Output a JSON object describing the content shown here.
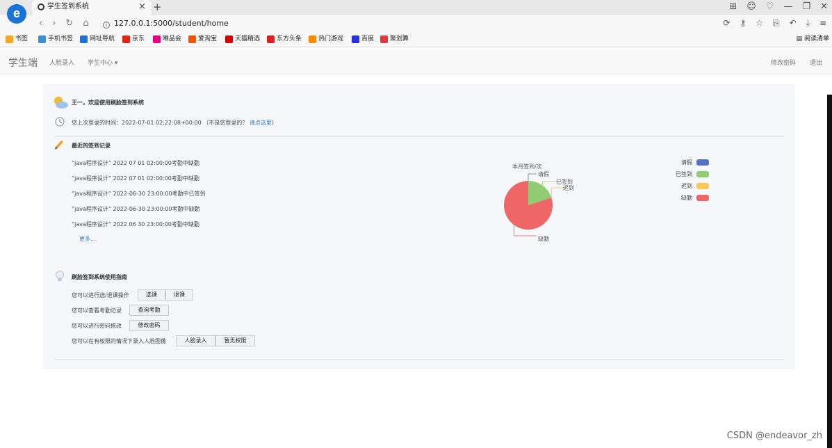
{
  "browser": {
    "tab_title": "学生签到系统",
    "tab_close": "×",
    "new_tab": "+",
    "url": "127.0.0.1:5000/student/home",
    "logo": "e",
    "reading_list": "阅读清单",
    "bookmarks": [
      {
        "label": "书签",
        "color": "#f5a623",
        "icon": "star-icon"
      },
      {
        "label": "手机书签",
        "color": "#3b8de0",
        "icon": "phone-icon"
      },
      {
        "label": "网址导航",
        "color": "#1a73d6",
        "icon": "browser-icon"
      },
      {
        "label": "京东",
        "color": "#e1251b",
        "icon": "jd-icon"
      },
      {
        "label": "唯品会",
        "color": "#e4007f",
        "icon": "vip-icon"
      },
      {
        "label": "爱淘宝",
        "color": "#ff5000",
        "icon": "taobao-icon"
      },
      {
        "label": "天猫精选",
        "color": "#d10000",
        "icon": "tmall-icon"
      },
      {
        "label": "东方头条",
        "color": "#e02020",
        "icon": "toutiao-icon"
      },
      {
        "label": "热门游戏",
        "color": "#ff8a00",
        "icon": "game-icon"
      },
      {
        "label": "百度",
        "color": "#2932e1",
        "icon": "baidu-icon"
      },
      {
        "label": "聚划算",
        "color": "#e4393c",
        "icon": "juhuasuan-icon"
      }
    ]
  },
  "nav": {
    "brand": "学生端",
    "face_entry": "人脸录入",
    "student_center": "学生中心 ▾",
    "change_password": "修改密码",
    "logout": "退出"
  },
  "welcome": {
    "title": "王一，欢迎使用刷脸签到系统",
    "last_login_prefix": "您上次登录的时间：2022-07-01 02:22:08+00:00",
    "not_you": "（不是您登录的？",
    "click_here": "请点这里",
    "close_paren": "）"
  },
  "records": {
    "title": "最近的签到记录",
    "items": [
      "“java程序设计” 2022 07 01 02:00:00考勤中缺勤",
      "“java程序设计” 2022 07 01 02:00:00考勤中缺勤",
      "“java程序设计” 2022-06-30 23:00:00考勤中已签到",
      "“java程序设计” 2022-06-30 23:00:00考勤中缺勤",
      "“java程序设计” 2022 06 30 23:00:00考勤中缺勤"
    ],
    "more": "更多..."
  },
  "chart_data": {
    "type": "pie",
    "title": "本月签到/次",
    "categories": [
      "请假",
      "已签到",
      "迟到",
      "缺勤"
    ],
    "values": [
      0,
      1,
      0,
      4
    ],
    "colors": [
      "#5470c6",
      "#91cc75",
      "#fac858",
      "#ee6666"
    ],
    "legend_position": "right"
  },
  "guide": {
    "title": "刷脸签到系统使用指南",
    "rows": [
      {
        "text": "您可以进行选/退课操作",
        "buttons": [
          "选课",
          "退课"
        ]
      },
      {
        "text": "您可以查看考勤记录",
        "buttons": [
          "查询考勤"
        ]
      },
      {
        "text": "您可以进行密码修改",
        "buttons": [
          "修改密码"
        ]
      },
      {
        "text": "您可以在有权限的情况下录入人脸图像",
        "buttons": [
          "人脸录入",
          "暂无权限"
        ]
      }
    ]
  },
  "watermark": "CSDN @endeavor_zh"
}
